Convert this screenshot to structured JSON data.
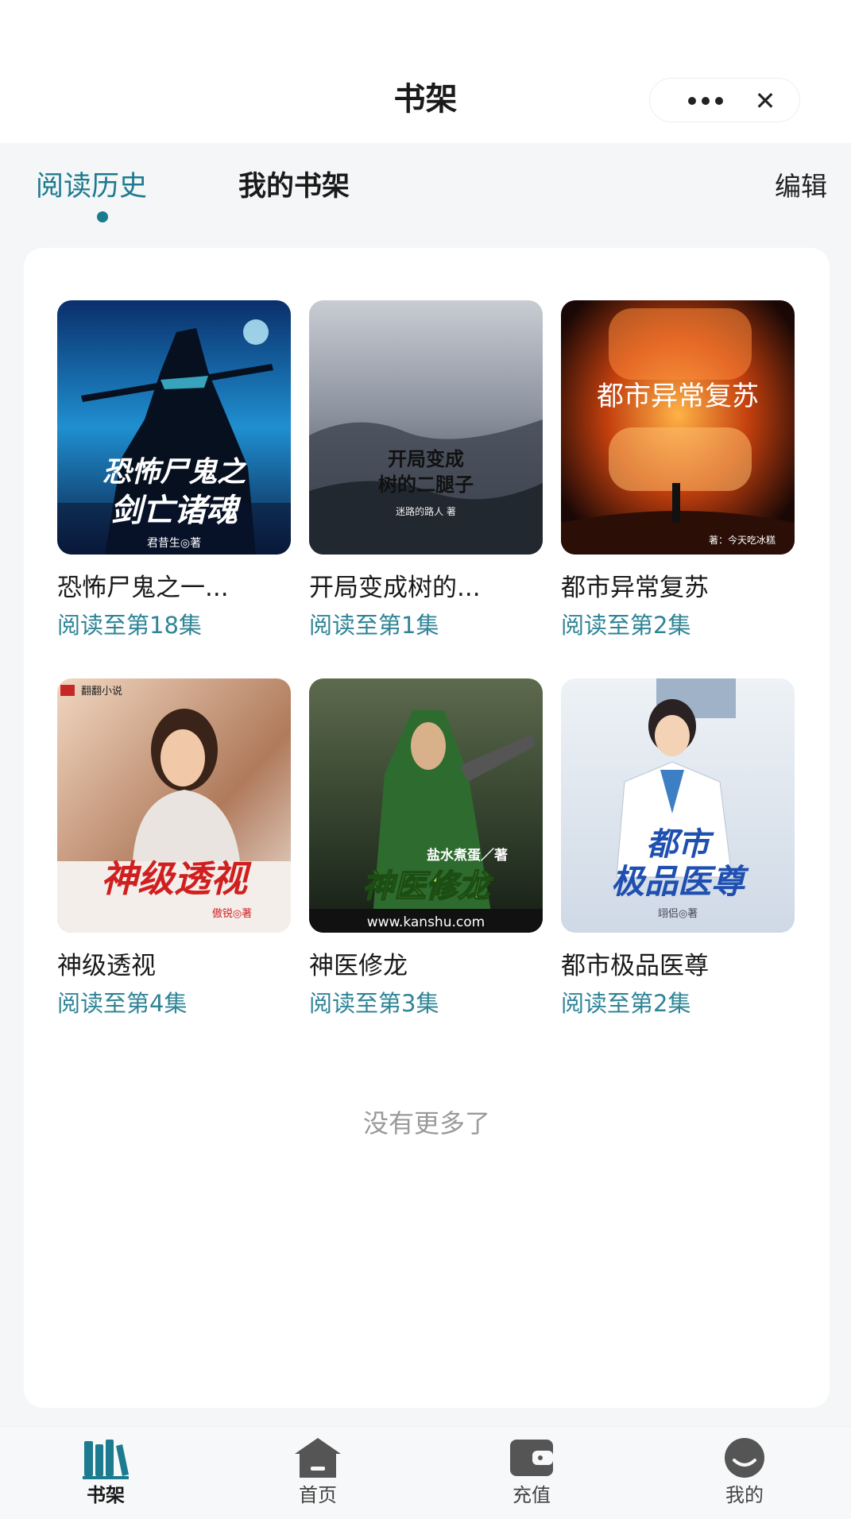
{
  "header": {
    "title": "书架"
  },
  "tabs": {
    "history": "阅读历史",
    "shelf": "我的书架",
    "edit": "编辑"
  },
  "books": [
    {
      "title": "恐怖尸鬼之一...",
      "progress": "阅读至第18集",
      "cover_text": "恐怖尸鬼之\n剑亡诸魂",
      "cover_author": "君昔生◎著"
    },
    {
      "title": "开局变成树的...",
      "progress": "阅读至第1集",
      "cover_text": "开局变成\n树的二腿子",
      "cover_author": "迷路的路人 著"
    },
    {
      "title": "都市异常复苏",
      "progress": "阅读至第2集",
      "cover_text": "都市异常复苏",
      "cover_author": "著：今天吃冰糕"
    },
    {
      "title": "神级透视",
      "progress": "阅读至第4集",
      "cover_text": "神级透视",
      "cover_author": "傲锐◎著",
      "cover_badge": "翻翻小说"
    },
    {
      "title": "神医修龙",
      "progress": "阅读至第3集",
      "cover_text": "神医修龙",
      "cover_author": "盐水煮蛋／著",
      "cover_url": "www.kanshu.com"
    },
    {
      "title": "都市极品医尊",
      "progress": "阅读至第2集",
      "cover_text": "都市\n极品医尊",
      "cover_author": "翊侣◎著"
    }
  ],
  "footer_text": "没有更多了",
  "nav": [
    {
      "label": "书架",
      "icon": "bookshelf-icon",
      "active": true
    },
    {
      "label": "首页",
      "icon": "home-icon",
      "active": false
    },
    {
      "label": "充值",
      "icon": "wallet-icon",
      "active": false
    },
    {
      "label": "我的",
      "icon": "profile-icon",
      "active": false
    }
  ],
  "colors": {
    "accent": "#1c7b8f",
    "progress": "#2f8496",
    "background": "#f4f6f8"
  }
}
